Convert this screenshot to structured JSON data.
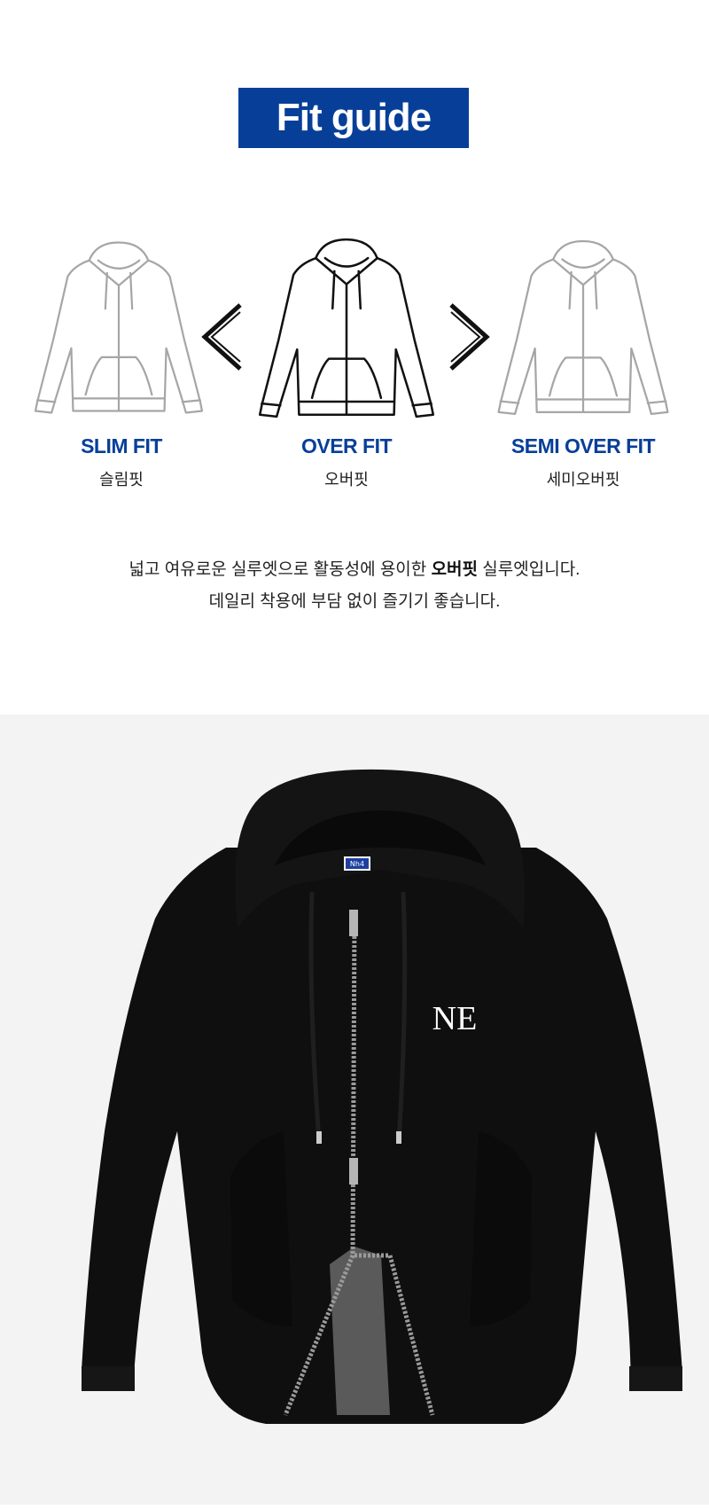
{
  "title": "Fit guide",
  "colors": {
    "brand_blue": "#073f98",
    "text": "#222222",
    "photo_bg": "#f3f3f3",
    "hoodie": "#111111"
  },
  "fits": [
    {
      "label": "SLIM FIT",
      "korean": "슬림핏",
      "icon": "hoodie-outline-icon",
      "selected": false
    },
    {
      "label": "OVER FIT",
      "korean": "오버핏",
      "icon": "hoodie-outline-icon",
      "selected": true
    },
    {
      "label": "SEMI OVER FIT",
      "korean": "세미오버핏",
      "icon": "hoodie-outline-icon",
      "selected": false
    }
  ],
  "description": {
    "line1_before": "넓고 여유로운 실루엣으로 활동성에 용이한 ",
    "line1_bold": "오버핏",
    "line1_after": " 실루엣입니다.",
    "line2": "데일리 착용에 부담 없이 즐기기 좋습니다."
  },
  "product_photo": {
    "label_tag": "Nh4",
    "logo_text": "NE"
  }
}
